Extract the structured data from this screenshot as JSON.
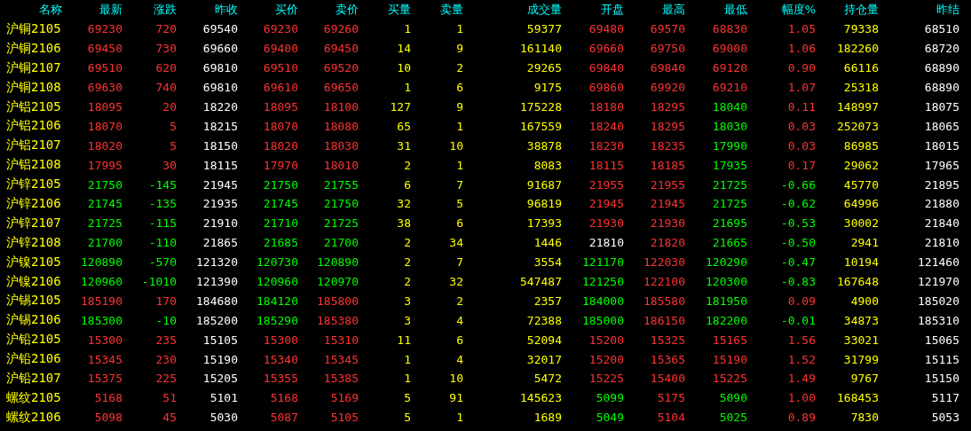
{
  "columns": [
    "名称",
    "最新",
    "涨跌",
    "昨收",
    "买价",
    "卖价",
    "买量",
    "卖量",
    "成交量",
    "开盘",
    "最高",
    "最低",
    "幅度%",
    "持仓量",
    "昨结"
  ],
  "rows": [
    {
      "name": "沪铜2105",
      "cells": [
        {
          "text": "69230",
          "color": "#ff3232"
        },
        {
          "text": "720",
          "color": "#ff3232"
        },
        {
          "text": "69540",
          "color": "#ffffff"
        },
        {
          "text": "69230",
          "color": "#ff3232"
        },
        {
          "text": "69260",
          "color": "#ff3232"
        },
        {
          "text": "1",
          "color": "#ffff00"
        },
        {
          "text": "1",
          "color": "#ffff00"
        },
        {
          "text": "59377",
          "color": "#ffff00"
        },
        {
          "text": "69480",
          "color": "#ff3232"
        },
        {
          "text": "69570",
          "color": "#ff3232"
        },
        {
          "text": "68830",
          "color": "#ff3232"
        },
        {
          "text": "1.05",
          "color": "#ff3232"
        },
        {
          "text": "79338",
          "color": "#ffff00"
        },
        {
          "text": "68510",
          "color": "#ffffff"
        }
      ]
    },
    {
      "name": "沪铜2106",
      "cells": [
        {
          "text": "69450",
          "color": "#ff3232"
        },
        {
          "text": "730",
          "color": "#ff3232"
        },
        {
          "text": "69660",
          "color": "#ffffff"
        },
        {
          "text": "69400",
          "color": "#ff3232"
        },
        {
          "text": "69450",
          "color": "#ff3232"
        },
        {
          "text": "14",
          "color": "#ffff00"
        },
        {
          "text": "9",
          "color": "#ffff00"
        },
        {
          "text": "161140",
          "color": "#ffff00"
        },
        {
          "text": "69660",
          "color": "#ff3232"
        },
        {
          "text": "69750",
          "color": "#ff3232"
        },
        {
          "text": "69000",
          "color": "#ff3232"
        },
        {
          "text": "1.06",
          "color": "#ff3232"
        },
        {
          "text": "182260",
          "color": "#ffff00"
        },
        {
          "text": "68720",
          "color": "#ffffff"
        }
      ]
    },
    {
      "name": "沪铜2107",
      "cells": [
        {
          "text": "69510",
          "color": "#ff3232"
        },
        {
          "text": "620",
          "color": "#ff3232"
        },
        {
          "text": "69810",
          "color": "#ffffff"
        },
        {
          "text": "69510",
          "color": "#ff3232"
        },
        {
          "text": "69520",
          "color": "#ff3232"
        },
        {
          "text": "10",
          "color": "#ffff00"
        },
        {
          "text": "2",
          "color": "#ffff00"
        },
        {
          "text": "29265",
          "color": "#ffff00"
        },
        {
          "text": "69840",
          "color": "#ff3232"
        },
        {
          "text": "69840",
          "color": "#ff3232"
        },
        {
          "text": "69120",
          "color": "#ff3232"
        },
        {
          "text": "0.90",
          "color": "#ff3232"
        },
        {
          "text": "66116",
          "color": "#ffff00"
        },
        {
          "text": "68890",
          "color": "#ffffff"
        }
      ]
    },
    {
      "name": "沪铜2108",
      "cells": [
        {
          "text": "69630",
          "color": "#ff3232"
        },
        {
          "text": "740",
          "color": "#ff3232"
        },
        {
          "text": "69810",
          "color": "#ffffff"
        },
        {
          "text": "69610",
          "color": "#ff3232"
        },
        {
          "text": "69650",
          "color": "#ff3232"
        },
        {
          "text": "1",
          "color": "#ffff00"
        },
        {
          "text": "6",
          "color": "#ffff00"
        },
        {
          "text": "9175",
          "color": "#ffff00"
        },
        {
          "text": "69860",
          "color": "#ff3232"
        },
        {
          "text": "69920",
          "color": "#ff3232"
        },
        {
          "text": "69210",
          "color": "#ff3232"
        },
        {
          "text": "1.07",
          "color": "#ff3232"
        },
        {
          "text": "25318",
          "color": "#ffff00"
        },
        {
          "text": "68890",
          "color": "#ffffff"
        }
      ]
    },
    {
      "name": "沪铝2105",
      "cells": [
        {
          "text": "18095",
          "color": "#ff3232"
        },
        {
          "text": "20",
          "color": "#ff3232"
        },
        {
          "text": "18220",
          "color": "#ffffff"
        },
        {
          "text": "18095",
          "color": "#ff3232"
        },
        {
          "text": "18100",
          "color": "#ff3232"
        },
        {
          "text": "127",
          "color": "#ffff00"
        },
        {
          "text": "9",
          "color": "#ffff00"
        },
        {
          "text": "175228",
          "color": "#ffff00"
        },
        {
          "text": "18180",
          "color": "#ff3232"
        },
        {
          "text": "18295",
          "color": "#ff3232"
        },
        {
          "text": "18040",
          "color": "#00ff00"
        },
        {
          "text": "0.11",
          "color": "#ff3232"
        },
        {
          "text": "148997",
          "color": "#ffff00"
        },
        {
          "text": "18075",
          "color": "#ffffff"
        }
      ]
    },
    {
      "name": "沪铝2106",
      "cells": [
        {
          "text": "18070",
          "color": "#ff3232"
        },
        {
          "text": "5",
          "color": "#ff3232"
        },
        {
          "text": "18215",
          "color": "#ffffff"
        },
        {
          "text": "18070",
          "color": "#ff3232"
        },
        {
          "text": "18080",
          "color": "#ff3232"
        },
        {
          "text": "65",
          "color": "#ffff00"
        },
        {
          "text": "1",
          "color": "#ffff00"
        },
        {
          "text": "167559",
          "color": "#ffff00"
        },
        {
          "text": "18240",
          "color": "#ff3232"
        },
        {
          "text": "18295",
          "color": "#ff3232"
        },
        {
          "text": "18030",
          "color": "#00ff00"
        },
        {
          "text": "0.03",
          "color": "#ff3232"
        },
        {
          "text": "252073",
          "color": "#ffff00"
        },
        {
          "text": "18065",
          "color": "#ffffff"
        }
      ]
    },
    {
      "name": "沪铝2107",
      "cells": [
        {
          "text": "18020",
          "color": "#ff3232"
        },
        {
          "text": "5",
          "color": "#ff3232"
        },
        {
          "text": "18150",
          "color": "#ffffff"
        },
        {
          "text": "18020",
          "color": "#ff3232"
        },
        {
          "text": "18030",
          "color": "#ff3232"
        },
        {
          "text": "31",
          "color": "#ffff00"
        },
        {
          "text": "10",
          "color": "#ffff00"
        },
        {
          "text": "38878",
          "color": "#ffff00"
        },
        {
          "text": "18230",
          "color": "#ff3232"
        },
        {
          "text": "18235",
          "color": "#ff3232"
        },
        {
          "text": "17990",
          "color": "#00ff00"
        },
        {
          "text": "0.03",
          "color": "#ff3232"
        },
        {
          "text": "86985",
          "color": "#ffff00"
        },
        {
          "text": "18015",
          "color": "#ffffff"
        }
      ]
    },
    {
      "name": "沪铝2108",
      "cells": [
        {
          "text": "17995",
          "color": "#ff3232"
        },
        {
          "text": "30",
          "color": "#ff3232"
        },
        {
          "text": "18115",
          "color": "#ffffff"
        },
        {
          "text": "17970",
          "color": "#ff3232"
        },
        {
          "text": "18010",
          "color": "#ff3232"
        },
        {
          "text": "2",
          "color": "#ffff00"
        },
        {
          "text": "1",
          "color": "#ffff00"
        },
        {
          "text": "8083",
          "color": "#ffff00"
        },
        {
          "text": "18115",
          "color": "#ff3232"
        },
        {
          "text": "18185",
          "color": "#ff3232"
        },
        {
          "text": "17935",
          "color": "#00ff00"
        },
        {
          "text": "0.17",
          "color": "#ff3232"
        },
        {
          "text": "29062",
          "color": "#ffff00"
        },
        {
          "text": "17965",
          "color": "#ffffff"
        }
      ]
    },
    {
      "name": "沪锌2105",
      "cells": [
        {
          "text": "21750",
          "color": "#00ff00"
        },
        {
          "text": "-145",
          "color": "#00ff00"
        },
        {
          "text": "21945",
          "color": "#ffffff"
        },
        {
          "text": "21750",
          "color": "#00ff00"
        },
        {
          "text": "21755",
          "color": "#00ff00"
        },
        {
          "text": "6",
          "color": "#ffff00"
        },
        {
          "text": "7",
          "color": "#ffff00"
        },
        {
          "text": "91687",
          "color": "#ffff00"
        },
        {
          "text": "21955",
          "color": "#ff3232"
        },
        {
          "text": "21955",
          "color": "#ff3232"
        },
        {
          "text": "21725",
          "color": "#00ff00"
        },
        {
          "text": "-0.66",
          "color": "#00ff00"
        },
        {
          "text": "45770",
          "color": "#ffff00"
        },
        {
          "text": "21895",
          "color": "#ffffff"
        }
      ]
    },
    {
      "name": "沪锌2106",
      "cells": [
        {
          "text": "21745",
          "color": "#00ff00"
        },
        {
          "text": "-135",
          "color": "#00ff00"
        },
        {
          "text": "21935",
          "color": "#ffffff"
        },
        {
          "text": "21745",
          "color": "#00ff00"
        },
        {
          "text": "21750",
          "color": "#00ff00"
        },
        {
          "text": "32",
          "color": "#ffff00"
        },
        {
          "text": "5",
          "color": "#ffff00"
        },
        {
          "text": "96819",
          "color": "#ffff00"
        },
        {
          "text": "21945",
          "color": "#ff3232"
        },
        {
          "text": "21945",
          "color": "#ff3232"
        },
        {
          "text": "21725",
          "color": "#00ff00"
        },
        {
          "text": "-0.62",
          "color": "#00ff00"
        },
        {
          "text": "64996",
          "color": "#ffff00"
        },
        {
          "text": "21880",
          "color": "#ffffff"
        }
      ]
    },
    {
      "name": "沪锌2107",
      "cells": [
        {
          "text": "21725",
          "color": "#00ff00"
        },
        {
          "text": "-115",
          "color": "#00ff00"
        },
        {
          "text": "21910",
          "color": "#ffffff"
        },
        {
          "text": "21710",
          "color": "#00ff00"
        },
        {
          "text": "21725",
          "color": "#00ff00"
        },
        {
          "text": "38",
          "color": "#ffff00"
        },
        {
          "text": "6",
          "color": "#ffff00"
        },
        {
          "text": "17393",
          "color": "#ffff00"
        },
        {
          "text": "21930",
          "color": "#ff3232"
        },
        {
          "text": "21930",
          "color": "#ff3232"
        },
        {
          "text": "21695",
          "color": "#00ff00"
        },
        {
          "text": "-0.53",
          "color": "#00ff00"
        },
        {
          "text": "30002",
          "color": "#ffff00"
        },
        {
          "text": "21840",
          "color": "#ffffff"
        }
      ]
    },
    {
      "name": "沪锌2108",
      "cells": [
        {
          "text": "21700",
          "color": "#00ff00"
        },
        {
          "text": "-110",
          "color": "#00ff00"
        },
        {
          "text": "21865",
          "color": "#ffffff"
        },
        {
          "text": "21685",
          "color": "#00ff00"
        },
        {
          "text": "21700",
          "color": "#00ff00"
        },
        {
          "text": "2",
          "color": "#ffff00"
        },
        {
          "text": "34",
          "color": "#ffff00"
        },
        {
          "text": "1446",
          "color": "#ffff00"
        },
        {
          "text": "21810",
          "color": "#ffffff"
        },
        {
          "text": "21820",
          "color": "#ff3232"
        },
        {
          "text": "21665",
          "color": "#00ff00"
        },
        {
          "text": "-0.50",
          "color": "#00ff00"
        },
        {
          "text": "2941",
          "color": "#ffff00"
        },
        {
          "text": "21810",
          "color": "#ffffff"
        }
      ]
    },
    {
      "name": "沪镍2105",
      "cells": [
        {
          "text": "120890",
          "color": "#00ff00"
        },
        {
          "text": "-570",
          "color": "#00ff00"
        },
        {
          "text": "121320",
          "color": "#ffffff"
        },
        {
          "text": "120730",
          "color": "#00ff00"
        },
        {
          "text": "120890",
          "color": "#00ff00"
        },
        {
          "text": "2",
          "color": "#ffff00"
        },
        {
          "text": "7",
          "color": "#ffff00"
        },
        {
          "text": "3554",
          "color": "#ffff00"
        },
        {
          "text": "121170",
          "color": "#00ff00"
        },
        {
          "text": "122030",
          "color": "#ff3232"
        },
        {
          "text": "120290",
          "color": "#00ff00"
        },
        {
          "text": "-0.47",
          "color": "#00ff00"
        },
        {
          "text": "10194",
          "color": "#ffff00"
        },
        {
          "text": "121460",
          "color": "#ffffff"
        }
      ]
    },
    {
      "name": "沪镍2106",
      "cells": [
        {
          "text": "120960",
          "color": "#00ff00"
        },
        {
          "text": "-1010",
          "color": "#00ff00"
        },
        {
          "text": "121390",
          "color": "#ffffff"
        },
        {
          "text": "120960",
          "color": "#00ff00"
        },
        {
          "text": "120970",
          "color": "#00ff00"
        },
        {
          "text": "2",
          "color": "#ffff00"
        },
        {
          "text": "32",
          "color": "#ffff00"
        },
        {
          "text": "547487",
          "color": "#ffff00"
        },
        {
          "text": "121250",
          "color": "#00ff00"
        },
        {
          "text": "122100",
          "color": "#ff3232"
        },
        {
          "text": "120300",
          "color": "#00ff00"
        },
        {
          "text": "-0.83",
          "color": "#00ff00"
        },
        {
          "text": "167648",
          "color": "#ffff00"
        },
        {
          "text": "121970",
          "color": "#ffffff"
        }
      ]
    },
    {
      "name": "沪锡2105",
      "cells": [
        {
          "text": "185190",
          "color": "#ff3232"
        },
        {
          "text": "170",
          "color": "#ff3232"
        },
        {
          "text": "184680",
          "color": "#ffffff"
        },
        {
          "text": "184120",
          "color": "#00ff00"
        },
        {
          "text": "185800",
          "color": "#ff3232"
        },
        {
          "text": "3",
          "color": "#ffff00"
        },
        {
          "text": "2",
          "color": "#ffff00"
        },
        {
          "text": "2357",
          "color": "#ffff00"
        },
        {
          "text": "184000",
          "color": "#00ff00"
        },
        {
          "text": "185580",
          "color": "#ff3232"
        },
        {
          "text": "181950",
          "color": "#00ff00"
        },
        {
          "text": "0.09",
          "color": "#ff3232"
        },
        {
          "text": "4900",
          "color": "#ffff00"
        },
        {
          "text": "185020",
          "color": "#ffffff"
        }
      ]
    },
    {
      "name": "沪锡2106",
      "cells": [
        {
          "text": "185300",
          "color": "#00ff00"
        },
        {
          "text": "-10",
          "color": "#00ff00"
        },
        {
          "text": "185200",
          "color": "#ffffff"
        },
        {
          "text": "185290",
          "color": "#00ff00"
        },
        {
          "text": "185380",
          "color": "#ff3232"
        },
        {
          "text": "3",
          "color": "#ffff00"
        },
        {
          "text": "4",
          "color": "#ffff00"
        },
        {
          "text": "72388",
          "color": "#ffff00"
        },
        {
          "text": "185000",
          "color": "#00ff00"
        },
        {
          "text": "186150",
          "color": "#ff3232"
        },
        {
          "text": "182200",
          "color": "#00ff00"
        },
        {
          "text": "-0.01",
          "color": "#00ff00"
        },
        {
          "text": "34873",
          "color": "#ffff00"
        },
        {
          "text": "185310",
          "color": "#ffffff"
        }
      ]
    },
    {
      "name": "沪铅2105",
      "cells": [
        {
          "text": "15300",
          "color": "#ff3232"
        },
        {
          "text": "235",
          "color": "#ff3232"
        },
        {
          "text": "15105",
          "color": "#ffffff"
        },
        {
          "text": "15300",
          "color": "#ff3232"
        },
        {
          "text": "15310",
          "color": "#ff3232"
        },
        {
          "text": "11",
          "color": "#ffff00"
        },
        {
          "text": "6",
          "color": "#ffff00"
        },
        {
          "text": "52094",
          "color": "#ffff00"
        },
        {
          "text": "15200",
          "color": "#ff3232"
        },
        {
          "text": "15325",
          "color": "#ff3232"
        },
        {
          "text": "15165",
          "color": "#ff3232"
        },
        {
          "text": "1.56",
          "color": "#ff3232"
        },
        {
          "text": "33021",
          "color": "#ffff00"
        },
        {
          "text": "15065",
          "color": "#ffffff"
        }
      ]
    },
    {
      "name": "沪铅2106",
      "cells": [
        {
          "text": "15345",
          "color": "#ff3232"
        },
        {
          "text": "230",
          "color": "#ff3232"
        },
        {
          "text": "15190",
          "color": "#ffffff"
        },
        {
          "text": "15340",
          "color": "#ff3232"
        },
        {
          "text": "15345",
          "color": "#ff3232"
        },
        {
          "text": "1",
          "color": "#ffff00"
        },
        {
          "text": "4",
          "color": "#ffff00"
        },
        {
          "text": "32017",
          "color": "#ffff00"
        },
        {
          "text": "15200",
          "color": "#ff3232"
        },
        {
          "text": "15365",
          "color": "#ff3232"
        },
        {
          "text": "15190",
          "color": "#ff3232"
        },
        {
          "text": "1.52",
          "color": "#ff3232"
        },
        {
          "text": "31799",
          "color": "#ffff00"
        },
        {
          "text": "15115",
          "color": "#ffffff"
        }
      ]
    },
    {
      "name": "沪铅2107",
      "cells": [
        {
          "text": "15375",
          "color": "#ff3232"
        },
        {
          "text": "225",
          "color": "#ff3232"
        },
        {
          "text": "15205",
          "color": "#ffffff"
        },
        {
          "text": "15355",
          "color": "#ff3232"
        },
        {
          "text": "15385",
          "color": "#ff3232"
        },
        {
          "text": "1",
          "color": "#ffff00"
        },
        {
          "text": "10",
          "color": "#ffff00"
        },
        {
          "text": "5472",
          "color": "#ffff00"
        },
        {
          "text": "15225",
          "color": "#ff3232"
        },
        {
          "text": "15400",
          "color": "#ff3232"
        },
        {
          "text": "15225",
          "color": "#ff3232"
        },
        {
          "text": "1.49",
          "color": "#ff3232"
        },
        {
          "text": "9767",
          "color": "#ffff00"
        },
        {
          "text": "15150",
          "color": "#ffffff"
        }
      ]
    },
    {
      "name": "螺纹2105",
      "cells": [
        {
          "text": "5168",
          "color": "#ff3232"
        },
        {
          "text": "51",
          "color": "#ff3232"
        },
        {
          "text": "5101",
          "color": "#ffffff"
        },
        {
          "text": "5168",
          "color": "#ff3232"
        },
        {
          "text": "5169",
          "color": "#ff3232"
        },
        {
          "text": "5",
          "color": "#ffff00"
        },
        {
          "text": "91",
          "color": "#ffff00"
        },
        {
          "text": "145623",
          "color": "#ffff00"
        },
        {
          "text": "5099",
          "color": "#00ff00"
        },
        {
          "text": "5175",
          "color": "#ff3232"
        },
        {
          "text": "5090",
          "color": "#00ff00"
        },
        {
          "text": "1.00",
          "color": "#ff3232"
        },
        {
          "text": "168453",
          "color": "#ffff00"
        },
        {
          "text": "5117",
          "color": "#ffffff"
        }
      ]
    },
    {
      "name": "螺纹2106",
      "cells": [
        {
          "text": "5098",
          "color": "#ff3232"
        },
        {
          "text": "45",
          "color": "#ff3232"
        },
        {
          "text": "5030",
          "color": "#ffffff"
        },
        {
          "text": "5087",
          "color": "#ff3232"
        },
        {
          "text": "5105",
          "color": "#ff3232"
        },
        {
          "text": "5",
          "color": "#ffff00"
        },
        {
          "text": "1",
          "color": "#ffff00"
        },
        {
          "text": "1689",
          "color": "#ffff00"
        },
        {
          "text": "5049",
          "color": "#00ff00"
        },
        {
          "text": "5104",
          "color": "#ff3232"
        },
        {
          "text": "5025",
          "color": "#00ff00"
        },
        {
          "text": "0.89",
          "color": "#ff3232"
        },
        {
          "text": "7830",
          "color": "#ffff00"
        },
        {
          "text": "5053",
          "color": "#ffffff"
        }
      ]
    }
  ]
}
